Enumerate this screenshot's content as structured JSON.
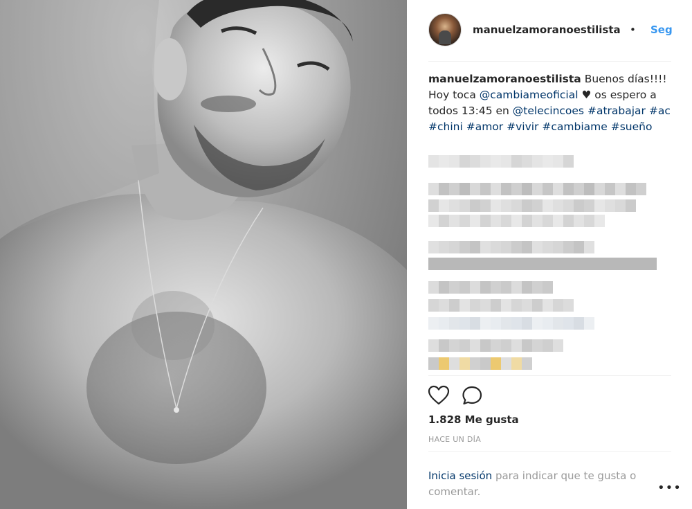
{
  "post": {
    "username": "manuelzamoranoestilista",
    "dot": "•",
    "follow_label": "Seg",
    "caption": {
      "author": "manuelzamoranoestilista",
      "t1": " Buenos días!!!! Hoy toca ",
      "mention1": "@cambiameoficial",
      "t2": " ♥ os espero a todos 13:45 en ",
      "mention2": "@telecincoes",
      "t3": " ",
      "tag1": "#atrabajar",
      "tag2": "#ac",
      "tag3": "#chini",
      "tag4": "#amor",
      "tag5": "#vivir",
      "tag6": "#cambiame",
      "tag7": "#sueño"
    },
    "likes": "1.828 Me gusta",
    "time": "HACE UN DÍA",
    "login": {
      "link": "Inicia sesión",
      "rest": " para indicar que te gusta o comentar."
    },
    "more": "•••"
  },
  "icons": {
    "like": "heart-icon",
    "comment": "comment-bubble-icon",
    "more": "more-options-icon"
  },
  "colors": {
    "link": "#003569",
    "follow": "#3897f0",
    "muted": "#999999",
    "text": "#262626"
  }
}
